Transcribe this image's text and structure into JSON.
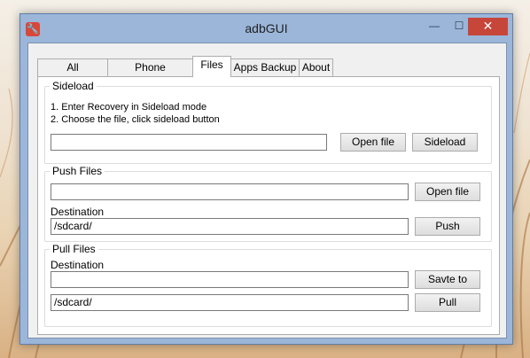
{
  "window": {
    "title": "adbGUI",
    "minimize": "—",
    "maximize": "☐",
    "close": "✕"
  },
  "tabs": [
    {
      "label": "All Commands"
    },
    {
      "label": "Phone Information"
    },
    {
      "label": "Files"
    },
    {
      "label": "Apps Backup"
    },
    {
      "label": "About"
    }
  ],
  "sideload": {
    "title": "Sideload",
    "step1": "1.  Enter Recovery in Sideload mode",
    "step2": "2.  Choose the file, click sideload button",
    "file_value": "",
    "open_file": "Open file",
    "sideload_button": "Sideload"
  },
  "push": {
    "title": "Push Files",
    "file_value": "",
    "open_file": "Open file",
    "destination_label": "Destination",
    "destination_value": "/sdcard/",
    "push_button": "Push"
  },
  "pull": {
    "title": "Pull Files",
    "destination_label": "Destination",
    "destination_value": "",
    "save_button": "Savte to",
    "source_value": "/sdcard/",
    "pull_button": "Pull"
  }
}
